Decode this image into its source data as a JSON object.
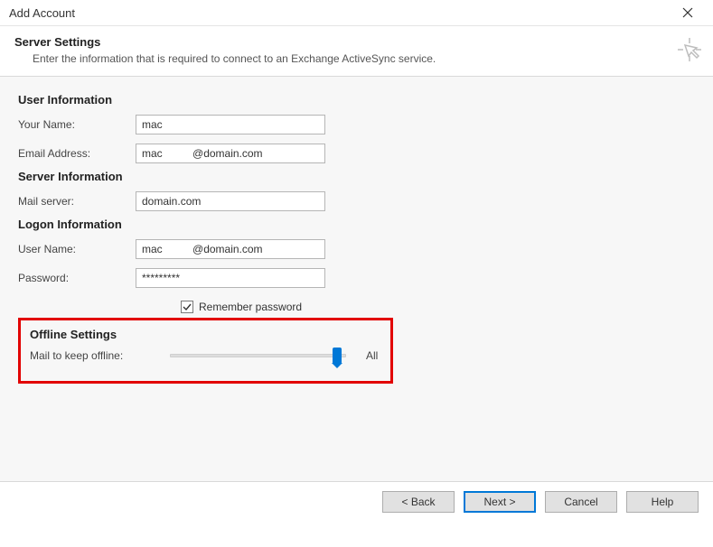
{
  "window": {
    "title": "Add Account"
  },
  "header": {
    "title": "Server Settings",
    "subtitle": "Enter the information that is required to connect to an Exchange ActiveSync service."
  },
  "sections": {
    "user_info": {
      "title": "User Information",
      "name_label": "Your Name:",
      "name_value": "mac",
      "email_label": "Email Address:",
      "email_value": "mac          @domain.com"
    },
    "server_info": {
      "title": "Server Information",
      "mail_server_label": "Mail server:",
      "mail_server_value": "domain.com"
    },
    "logon_info": {
      "title": "Logon Information",
      "username_label": "User Name:",
      "username_value": "mac          @domain.com",
      "password_label": "Password:",
      "password_value": "*********",
      "remember_label": "Remember password",
      "remember_checked": true
    },
    "offline": {
      "title": "Offline Settings",
      "slider_label": "Mail to keep offline:",
      "slider_value": "All"
    }
  },
  "footer": {
    "back": "< Back",
    "next": "Next >",
    "cancel": "Cancel",
    "help": "Help"
  }
}
